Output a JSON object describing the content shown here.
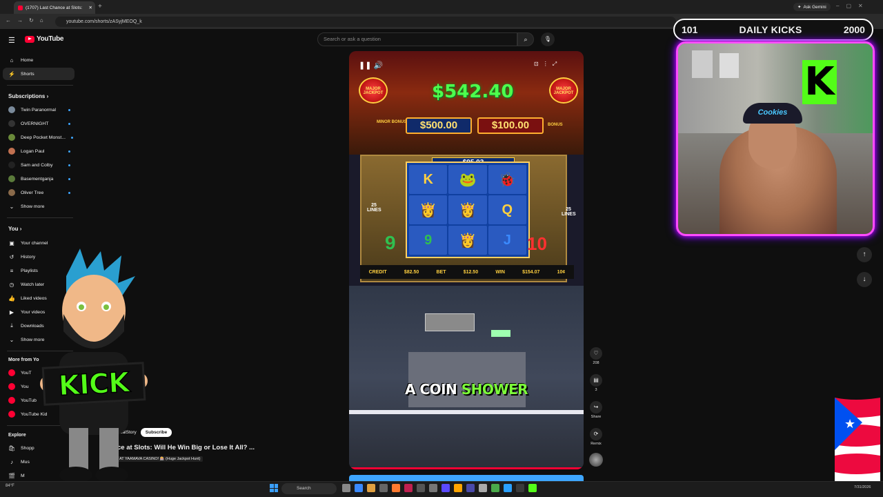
{
  "browser": {
    "tab_title": "(1707) Last Chance at Slots:",
    "new_tab": "+",
    "url": "youtube.com/shorts/zASyjMEOQ_k",
    "ask_gemini": "Ask Gemini"
  },
  "youtube": {
    "logo_text": "YouTube",
    "search_placeholder": "Search or ask a question",
    "nav": [
      {
        "label": "Home",
        "icon": "⌂"
      },
      {
        "label": "Shorts",
        "icon": "⚡"
      }
    ],
    "subscriptions_heading": "Subscriptions",
    "subscriptions": [
      {
        "label": "Twin Paranormal",
        "color": "#7a8a9a"
      },
      {
        "label": "OVERNIGHT",
        "color": "#333"
      },
      {
        "label": "Deep Pocket Monst...",
        "color": "#6a8a3a"
      },
      {
        "label": "Logan Paul",
        "color": "#c07050"
      },
      {
        "label": "Sam and Colby",
        "color": "#222"
      },
      {
        "label": "Basementganja",
        "color": "#5a7a3a"
      },
      {
        "label": "Oliver Tree",
        "color": "#8a6a4a"
      }
    ],
    "show_more": "Show more",
    "you_heading": "You",
    "you_items": [
      {
        "label": "Your channel",
        "icon": "▣"
      },
      {
        "label": "History",
        "icon": "↺"
      },
      {
        "label": "Playlists",
        "icon": "≡"
      },
      {
        "label": "Watch later",
        "icon": "◷"
      },
      {
        "label": "Liked videos",
        "icon": "👍"
      },
      {
        "label": "Your videos",
        "icon": "▶"
      },
      {
        "label": "Downloads",
        "icon": "⤓"
      },
      {
        "label": "Show more",
        "icon": "⌄"
      }
    ],
    "more_heading": "More from Yo",
    "more_items": [
      {
        "label": "YouT",
        "color": "#ff0033"
      },
      {
        "label": "You",
        "color": "#ff0033"
      },
      {
        "label": "YouTub",
        "color": "#ff0033"
      },
      {
        "label": "YouTube Kid",
        "color": "#ff0033"
      }
    ],
    "explore_heading": "Explore",
    "explore_items": [
      {
        "label": "Shopp",
        "icon": "🛍"
      },
      {
        "label": "Mus",
        "icon": "♪"
      },
      {
        "label": "M",
        "icon": "🎬"
      }
    ]
  },
  "short": {
    "jackpot_amount": "$542.40",
    "jackpot_left": "MAJOR JACKPOT",
    "jackpot_right": "MAJOR JACKPOT",
    "minor_value": "$500.00",
    "mini_value": "$100.00",
    "minor_label": "MINOR BONUS",
    "mini_label": "BONUS",
    "bonus_line": "$95.03",
    "reels": [
      "K",
      "🐸",
      "🐞",
      "👸",
      "👸",
      "Q",
      "9",
      "👸",
      "J"
    ],
    "side_lines": "25 LINES",
    "bottom_left": "10",
    "credit_label": "CREDIT",
    "credit_value": "$82.50",
    "bet_label": "BET",
    "bet_value": "$12.50",
    "win_label": "WIN",
    "win_value": "$154.07",
    "denom": "10¢",
    "caption_plain": "A COIN",
    "caption_highlight": "SHOWER",
    "progress": 1.0,
    "actions": [
      {
        "icon": "♡",
        "label": "208"
      },
      {
        "icon": "▤",
        "label": "3"
      },
      {
        "icon": "↪",
        "label": "Share"
      },
      {
        "icon": "⟳",
        "label": "Remix"
      }
    ]
  },
  "channel_row": {
    "name": "sRealStory",
    "subscribe": "Subscribe",
    "title": "ce at Slots: Will He Win Big or Lose It All? ...",
    "tag": "AT YAAMAVA CASINO! 🎰 (Huge Jackpot Hunt)"
  },
  "overlay": {
    "kicks_current": "101",
    "kicks_label": "DAILY KICKS",
    "kicks_goal": "2000",
    "cap_text": "Cookies",
    "wall_letter": "K",
    "mascot_sign": "KICK",
    "flag_colors": [
      "#ed0a3f",
      "#ffffff",
      "#0050f0"
    ]
  },
  "taskbar": {
    "search": "Search",
    "weather": "84°F",
    "date": "7/31/2026"
  },
  "colors": {
    "accent": "#ff0033",
    "kick_green": "#53fc18",
    "neon": "#ff4dff"
  }
}
